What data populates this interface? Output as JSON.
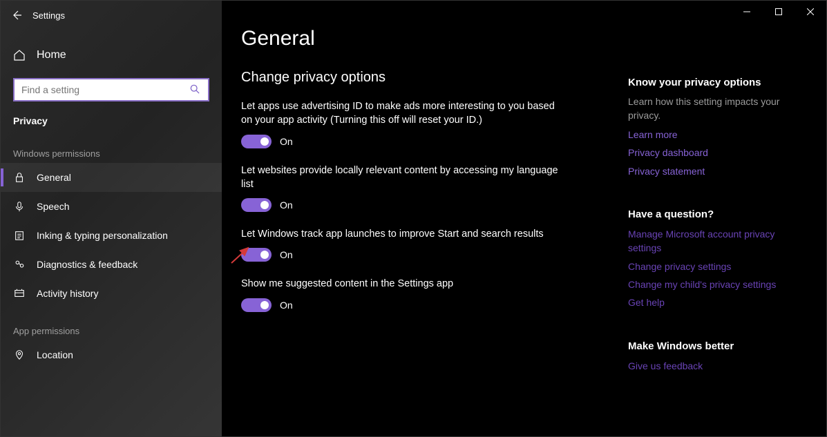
{
  "window": {
    "title": "Settings"
  },
  "sidebar": {
    "home": "Home",
    "search_placeholder": "Find a setting",
    "category": "Privacy",
    "section1": "Windows permissions",
    "section2": "App permissions",
    "items": [
      {
        "label": "General"
      },
      {
        "label": "Speech"
      },
      {
        "label": "Inking & typing personalization"
      },
      {
        "label": "Diagnostics & feedback"
      },
      {
        "label": "Activity history"
      }
    ],
    "app_items": [
      {
        "label": "Location"
      }
    ]
  },
  "main": {
    "title": "General",
    "subtitle": "Change privacy options",
    "settings": [
      {
        "desc": "Let apps use advertising ID to make ads more interesting to you based on your app activity (Turning this off will reset your ID.)",
        "state": "On"
      },
      {
        "desc": "Let websites provide locally relevant content by accessing my language list",
        "state": "On"
      },
      {
        "desc": "Let Windows track app launches to improve Start and search results",
        "state": "On"
      },
      {
        "desc": "Show me suggested content in the Settings app",
        "state": "On"
      }
    ]
  },
  "info": {
    "know": {
      "title": "Know your privacy options",
      "text": "Learn how this setting impacts your privacy.",
      "links": [
        "Learn more",
        "Privacy dashboard",
        "Privacy statement"
      ]
    },
    "question": {
      "title": "Have a question?",
      "links": [
        "Manage Microsoft account privacy settings",
        "Change privacy settings",
        "Change my child's privacy settings",
        "Get help"
      ]
    },
    "better": {
      "title": "Make Windows better",
      "links": [
        "Give us feedback"
      ]
    }
  }
}
